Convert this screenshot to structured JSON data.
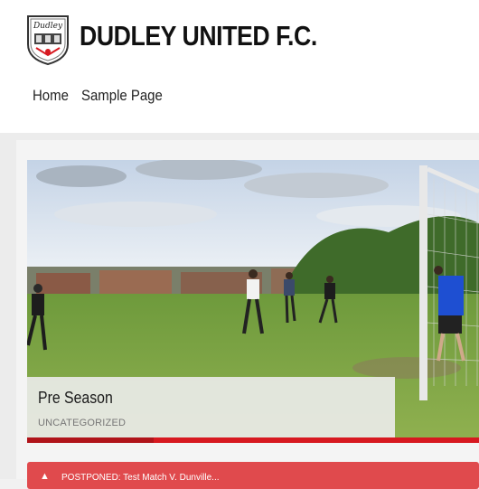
{
  "header": {
    "logo": {
      "name": "dudley-united-crest",
      "text": "Dudley",
      "accent": "#d71920"
    },
    "site_title": "DUDLEY UNITED F.C.",
    "nav": [
      {
        "label": "Home"
      },
      {
        "label": "Sample Page"
      }
    ]
  },
  "featured_post": {
    "title": "Pre Season",
    "category": "UNCATEGORIZED"
  },
  "ticker": {
    "icon": "warning-icon",
    "text": "POSTPONED: Test Match V. Dunville..."
  },
  "colors": {
    "accent_red": "#d71920",
    "ticker_red": "#e04a4d"
  }
}
